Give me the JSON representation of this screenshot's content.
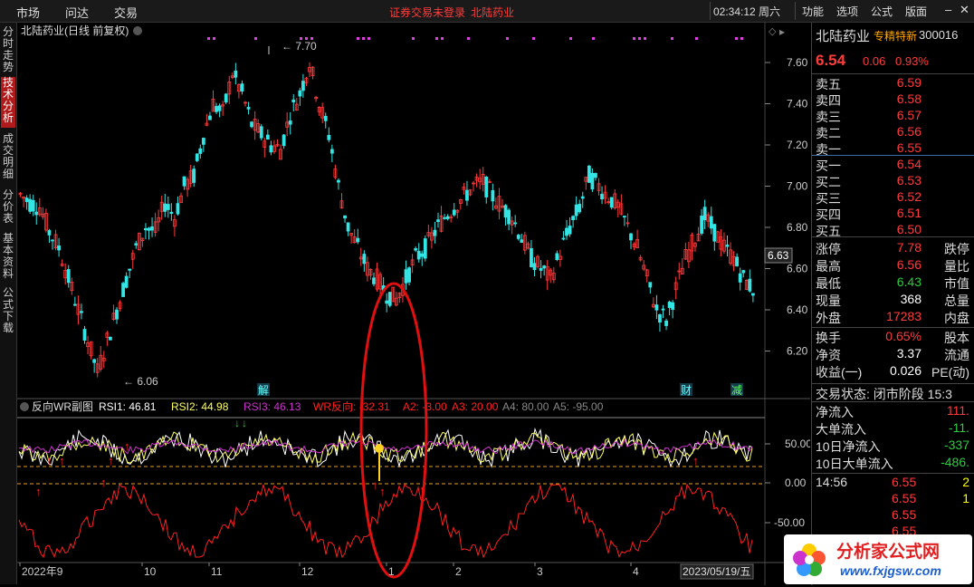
{
  "menu": {
    "items": [
      "市场",
      "问达",
      "交易"
    ],
    "notice1": "证券交易未登录",
    "notice2": "北陆药业",
    "clock": "02:34:12 周六",
    "right": [
      "功能",
      "选项",
      "公式",
      "版面"
    ]
  },
  "left_tabs": [
    "分时走势",
    "技术分析",
    "成交明细",
    "分价表",
    "基本资料",
    "公式下载"
  ],
  "stock_name": "北陆药业",
  "chart_title": "北陆药业(日线 前复权)",
  "indicator": {
    "name": "反向WR副图",
    "rsi1": "RSI1: 46.81",
    "rsi2": "RSI2: 44.98",
    "rsi3": "RSI3: 46.13",
    "wr": "WR反向: -32.31",
    "a2": "A2: -3.00",
    "a3": "A3: 20.00",
    "a4": "A4: 80.00",
    "a5": "A5: -95.00"
  },
  "main_axis": [
    "7.60",
    "7.40",
    "7.20",
    "7.00",
    "6.80",
    "6.60",
    "6.40",
    "6.20"
  ],
  "current_price_tag": "6.63",
  "high_label": "7.70",
  "low_label": "6.06",
  "event_labels": [
    "解",
    "财",
    "减"
  ],
  "sub_axis": [
    "50.00",
    "0.00",
    "-50.00"
  ],
  "x_axis": [
    "2022年9",
    "10",
    "11",
    "12",
    "1",
    "2",
    "3",
    "4",
    "2023/05/19/五"
  ],
  "right": {
    "name": "北陆药业",
    "badge": "专精特新",
    "code": "300016",
    "price": "6.54",
    "chg": "0.06",
    "pct": "0.93%",
    "asks": [
      {
        "k": "卖五",
        "v": "6.59"
      },
      {
        "k": "卖四",
        "v": "6.58"
      },
      {
        "k": "卖三",
        "v": "6.57"
      },
      {
        "k": "卖二",
        "v": "6.56"
      },
      {
        "k": "卖一",
        "v": "6.55"
      }
    ],
    "bids": [
      {
        "k": "买一",
        "v": "6.54"
      },
      {
        "k": "买二",
        "v": "6.53"
      },
      {
        "k": "买三",
        "v": "6.52"
      },
      {
        "k": "买四",
        "v": "6.51"
      },
      {
        "k": "买五",
        "v": "6.50"
      }
    ],
    "stats": [
      {
        "k": "涨停",
        "v": "7.78",
        "k2": "跌停"
      },
      {
        "k": "最高",
        "v": "6.56",
        "k2": "量比"
      },
      {
        "k": "最低",
        "v": "6.43",
        "k2": "市值"
      },
      {
        "k": "现量",
        "v": "368",
        "k2": "总量"
      },
      {
        "k": "外盘",
        "v": "17283",
        "k2": "内盘"
      }
    ],
    "stats2": [
      {
        "k": "换手",
        "v": "0.65%",
        "k2": "股本"
      },
      {
        "k": "净资",
        "v": "3.37",
        "k2": "流通"
      },
      {
        "k": "收益(一)",
        "v": "0.026",
        "k2": "PE(动)"
      }
    ],
    "status": "交易状态: 闭市阶段 15:3",
    "flows": [
      {
        "k": "净流入",
        "v": "111."
      },
      {
        "k": "大单流入",
        "v": "-11."
      },
      {
        "k": "10日净流入",
        "v": "-337"
      },
      {
        "k": "10日大单流入",
        "v": "-486."
      }
    ],
    "ticks": [
      {
        "t": "14:56",
        "p": "6.55",
        "q": "2"
      },
      {
        "t": "",
        "p": "6.55",
        "q": "1"
      },
      {
        "t": "",
        "p": "6.55",
        "q": ""
      },
      {
        "t": "",
        "p": "6.55",
        "q": ""
      }
    ]
  },
  "logo": {
    "text": "分析家公式网",
    "url": "www.fxjgsw.com"
  },
  "colors": {
    "up": "#ff3b3b",
    "down": "#33e5e5",
    "rsi1": "#ffffff",
    "rsi2": "#ffff66",
    "rsi3": "#cc33cc",
    "wr": "#ff2020"
  }
}
